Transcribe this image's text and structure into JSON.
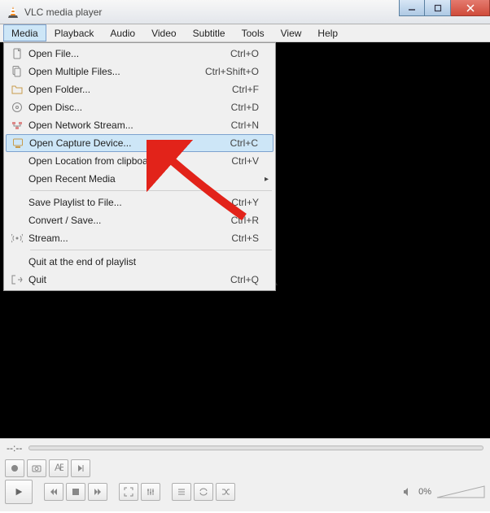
{
  "window": {
    "title": "VLC media player"
  },
  "menubar": {
    "items": [
      {
        "label": "Media",
        "active": true
      },
      {
        "label": "Playback"
      },
      {
        "label": "Audio"
      },
      {
        "label": "Video"
      },
      {
        "label": "Subtitle"
      },
      {
        "label": "Tools"
      },
      {
        "label": "View"
      },
      {
        "label": "Help"
      }
    ]
  },
  "dropdown": {
    "items": [
      {
        "icon": "file",
        "label": "Open File...",
        "shortcut": "Ctrl+O"
      },
      {
        "icon": "files",
        "label": "Open Multiple Files...",
        "shortcut": "Ctrl+Shift+O"
      },
      {
        "icon": "folder",
        "label": "Open Folder...",
        "shortcut": "Ctrl+F"
      },
      {
        "icon": "disc",
        "label": "Open Disc...",
        "shortcut": "Ctrl+D"
      },
      {
        "icon": "network",
        "label": "Open Network Stream...",
        "shortcut": "Ctrl+N"
      },
      {
        "icon": "capture",
        "label": "Open Capture Device...",
        "shortcut": "Ctrl+C",
        "highlight": true
      },
      {
        "icon": "",
        "label": "Open Location from clipboard",
        "shortcut": "Ctrl+V"
      },
      {
        "icon": "",
        "label": "Open Recent Media",
        "shortcut": "",
        "submenu": true
      },
      {
        "sep": true
      },
      {
        "icon": "",
        "label": "Save Playlist to File...",
        "shortcut": "Ctrl+Y"
      },
      {
        "icon": "",
        "label": "Convert / Save...",
        "shortcut": "Ctrl+R"
      },
      {
        "icon": "stream",
        "label": "Stream...",
        "shortcut": "Ctrl+S"
      },
      {
        "sep": true
      },
      {
        "icon": "",
        "label": "Quit at the end of playlist",
        "shortcut": ""
      },
      {
        "icon": "quit",
        "label": "Quit",
        "shortcut": "Ctrl+Q"
      }
    ]
  },
  "seek": {
    "time": "--:--"
  },
  "volume": {
    "pct": "0%"
  }
}
